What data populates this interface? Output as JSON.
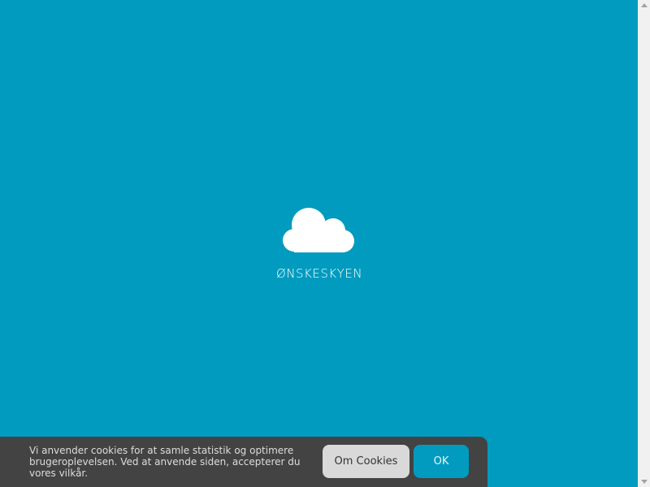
{
  "brand": {
    "name": "ØNSKESKYEN",
    "logo_icon": "cloud-icon"
  },
  "cookie_banner": {
    "message": "Vi anvender cookies for at samle statistik og optimere brugeroplevelsen. Ved at anvende siden, accepterer du vores vilkår.",
    "about_label": "Om Cookies",
    "ok_label": "OK"
  },
  "colors": {
    "background": "#009bbf",
    "banner": "#434343",
    "about_button": "#d9d9d9",
    "ok_button": "#009bbf"
  }
}
